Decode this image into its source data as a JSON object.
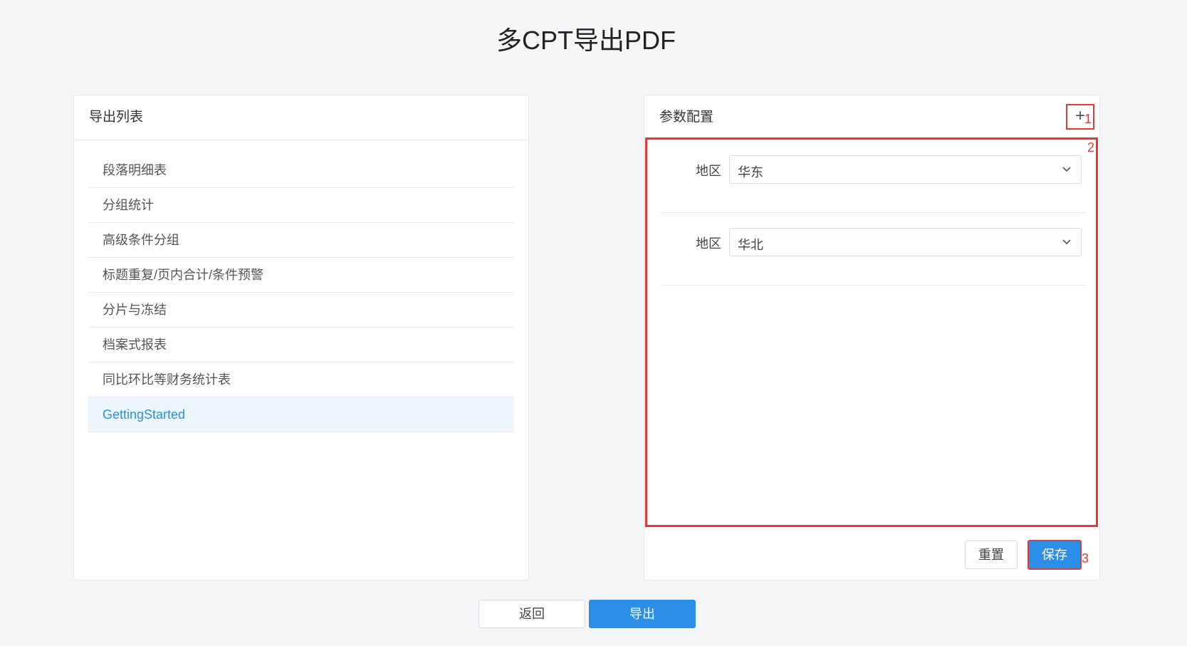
{
  "title": "多CPT导出PDF",
  "export_panel": {
    "header": "导出列表",
    "items": [
      {
        "label": "段落明细表",
        "active": false
      },
      {
        "label": "分组统计",
        "active": false
      },
      {
        "label": "高级条件分组",
        "active": false
      },
      {
        "label": "标题重复/页内合计/条件预警",
        "active": false
      },
      {
        "label": "分片与冻结",
        "active": false
      },
      {
        "label": "档案式报表",
        "active": false
      },
      {
        "label": "同比环比等财务统计表",
        "active": false
      },
      {
        "label": "GettingStarted",
        "active": true
      }
    ]
  },
  "param_panel": {
    "header": "参数配置",
    "add_label": "+",
    "params": [
      {
        "label": "地区",
        "value": "华东"
      },
      {
        "label": "地区",
        "value": "华北"
      }
    ],
    "reset_label": "重置",
    "save_label": "保存"
  },
  "annotations": {
    "one": "1",
    "two": "2",
    "three": "3"
  },
  "footer": {
    "back_label": "返回",
    "export_label": "导出"
  },
  "colors": {
    "accent": "#2b8fe8",
    "highlight": "#e53935",
    "active_bg": "#eef6fd"
  },
  "icons": {
    "add": "plus-icon",
    "dropdown": "chevron-down-icon"
  }
}
